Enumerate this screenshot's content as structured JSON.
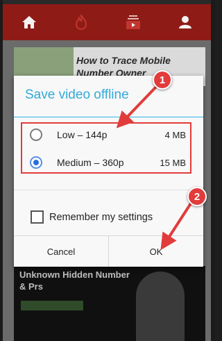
{
  "background": {
    "nav_icons": [
      "home-icon",
      "fire-icon",
      "subscriptions-icon",
      "account-icon"
    ],
    "card_title": "How to Trace Mobile Number Owner",
    "video_title": "Unknown Hidden Number & Prs",
    "brand_color": "#8e1b16"
  },
  "dialog": {
    "title": "Save video offline",
    "options": [
      {
        "label": "Low – 144p",
        "size": "4 MB",
        "selected": false
      },
      {
        "label": "Medium – 360p",
        "size": "15 MB",
        "selected": true
      }
    ],
    "remember_label": "Remember my settings",
    "remember_checked": false,
    "cancel_label": "Cancel",
    "ok_label": "OK",
    "accent_color": "#33a9d9"
  },
  "annotations": {
    "step1": "1",
    "step2": "2",
    "color": "#e23b3b"
  }
}
